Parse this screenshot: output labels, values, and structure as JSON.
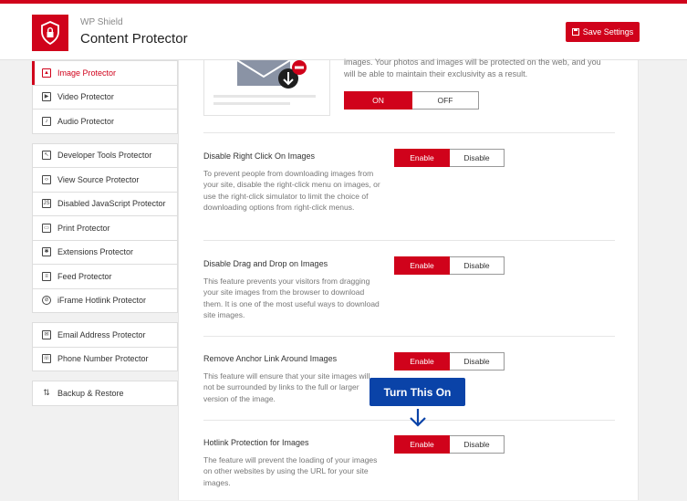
{
  "header": {
    "brand_small": "WP Shield",
    "brand_title": "Content Protector",
    "save_label": "Save Settings"
  },
  "sidebar": {
    "groups": [
      [
        {
          "label": "Image Protector",
          "icon": "image-icon",
          "active": true
        },
        {
          "label": "Video Protector",
          "icon": "play-icon"
        },
        {
          "label": "Audio Protector",
          "icon": "music-note-icon"
        }
      ],
      [
        {
          "label": "Developer Tools Protector",
          "icon": "cursor-icon"
        },
        {
          "label": "View Source Protector",
          "icon": "code-icon"
        },
        {
          "label": "Disabled JavaScript Protector",
          "icon": "js-icon"
        },
        {
          "label": "Print Protector",
          "icon": "printer-icon"
        },
        {
          "label": "Extensions Protector",
          "icon": "puzzle-icon"
        },
        {
          "label": "Feed Protector",
          "icon": "feed-icon"
        },
        {
          "label": "iFrame Hotlink Protector",
          "icon": "block-icon"
        }
      ],
      [
        {
          "label": "Email Address Protector",
          "icon": "envelope-icon"
        },
        {
          "label": "Phone Number Protector",
          "icon": "phone-icon"
        }
      ],
      [
        {
          "label": "Backup & Restore",
          "icon": "backup-icon"
        }
      ]
    ]
  },
  "hero": {
    "text_line1": "images. Your photos and images will be protected on the web, and you",
    "text_line2": "will be able to maintain their exclusivity as a result.",
    "on_label": "ON",
    "off_label": "OFF"
  },
  "sections": [
    {
      "title": "Disable Right Click On Images",
      "description": "To prevent people from downloading images from your site, disable the right-click menu on images, or use the right-click simulator to limit the choice of downloading options from right-click menus.",
      "enable_label": "Enable",
      "disable_label": "Disable"
    },
    {
      "title": "Disable Drag and Drop on Images",
      "description": "This feature prevents your visitors from dragging your site images from the browser to download them. It is one of the most useful ways to download site images.",
      "enable_label": "Enable",
      "disable_label": "Disable"
    },
    {
      "title": "Remove Anchor Link Around Images",
      "description": "This feature will ensure that your site images will not be surrounded by links to the full or larger version of the image.",
      "enable_label": "Enable",
      "disable_label": "Disable"
    },
    {
      "title": "Hotlink Protection for Images",
      "description": "The feature will prevent the loading of your images on other websites by using the URL for your site images.",
      "enable_label": "Enable",
      "disable_label": "Disable"
    }
  ],
  "callout": {
    "label": "Turn This On"
  },
  "colors": {
    "accent": "#d0021b",
    "callout": "#0a43a8"
  }
}
